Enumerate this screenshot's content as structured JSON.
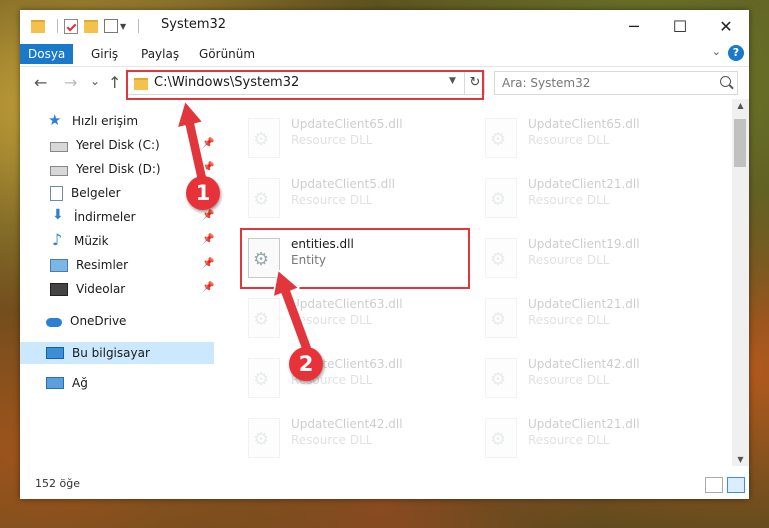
{
  "window": {
    "title": "System32"
  },
  "quick_access_icons": [
    "folder-icon",
    "properties-icon",
    "new-folder-icon",
    "customize-toolbar-icon"
  ],
  "window_controls": {
    "minimize": "─",
    "maximize": "☐",
    "close": "✕"
  },
  "ribbon": {
    "tabs": [
      {
        "label": "Dosya",
        "active": true
      },
      {
        "label": "Giriş"
      },
      {
        "label": "Paylaş"
      },
      {
        "label": "Görünüm"
      }
    ],
    "help": "?"
  },
  "navigation": {
    "back": "←",
    "forward": "→",
    "recent": "⌄",
    "up": "↑",
    "address": "C:\\Windows\\System32",
    "refresh": "↻",
    "search_placeholder": "Ara: System32"
  },
  "sidebar": {
    "items": [
      {
        "label": "Hızlı erişim",
        "icon": "star-icon"
      },
      {
        "label": "Yerel Disk (C:)",
        "icon": "drive-icon",
        "pinned": true
      },
      {
        "label": "Yerel Disk (D:)",
        "icon": "drive-icon",
        "pinned": true
      },
      {
        "label": "Belgeler",
        "icon": "documents-icon",
        "pinned": true
      },
      {
        "label": "İndirmeler",
        "icon": "downloads-icon",
        "pinned": true
      },
      {
        "label": "Müzik",
        "icon": "music-icon",
        "pinned": true
      },
      {
        "label": "Resimler",
        "icon": "pictures-icon",
        "pinned": true
      },
      {
        "label": "Videolar",
        "icon": "videos-icon",
        "pinned": true
      },
      {
        "label": "OneDrive",
        "icon": "cloud-icon"
      },
      {
        "label": "Bu bilgisayar",
        "icon": "computer-icon",
        "selected": true
      },
      {
        "label": "Ağ",
        "icon": "network-icon"
      }
    ]
  },
  "files": [
    {
      "name": "UpdateClient65.dll",
      "type": "Resource DLL",
      "faded": true
    },
    {
      "name": "UpdateClient65.dll",
      "type": "Resource DLL",
      "faded": true
    },
    {
      "name": "UpdateClient5.dll",
      "type": "Resource DLL",
      "faded": true
    },
    {
      "name": "UpdateClient21.dll",
      "type": "Resource DLL",
      "faded": true
    },
    {
      "name": "entities.dll",
      "type": "Entity",
      "faded": false
    },
    {
      "name": "UpdateClient19.dll",
      "type": "Resource DLL",
      "faded": true
    },
    {
      "name": "UpdateClient63.dll",
      "type": "Resource DLL",
      "faded": true
    },
    {
      "name": "UpdateClient21.dll",
      "type": "Resource DLL",
      "faded": true
    },
    {
      "name": "UpdateClient63.dll",
      "type": "Resource DLL",
      "faded": true
    },
    {
      "name": "UpdateClient42.dll",
      "type": "Resource DLL",
      "faded": true
    },
    {
      "name": "UpdateClient42.dll",
      "type": "Resource DLL",
      "faded": true
    },
    {
      "name": "UpdateClient21.dll",
      "type": "Resource DLL",
      "faded": true
    }
  ],
  "status": {
    "item_count": "152 öğe"
  },
  "callouts": [
    "1",
    "2"
  ],
  "annotation_color": "#e0363c"
}
